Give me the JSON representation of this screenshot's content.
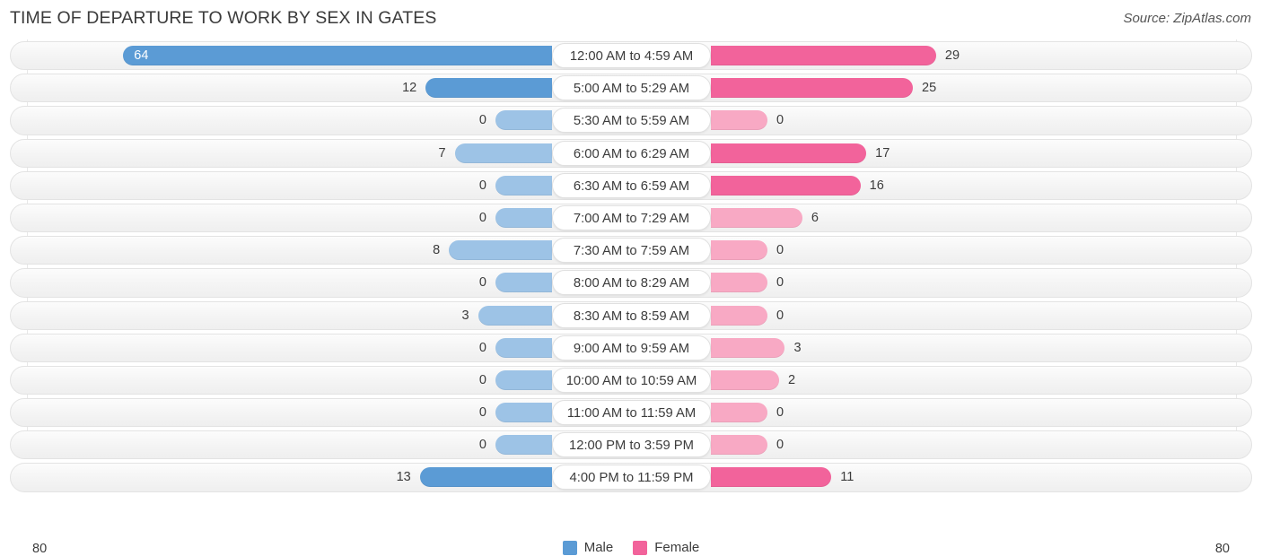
{
  "header": {
    "title": "TIME OF DEPARTURE TO WORK BY SEX IN GATES",
    "source": "Source: ZipAtlas.com"
  },
  "axis": {
    "left_label": "80",
    "right_label": "80",
    "max": 80
  },
  "legend": {
    "items": [
      {
        "label": "Male",
        "color": "#5b9bd5"
      },
      {
        "label": "Female",
        "color": "#f2639b"
      }
    ]
  },
  "colors": {
    "male_strong": "#5b9bd5",
    "male_light": "#9dc3e6",
    "female_strong": "#f2639b",
    "female_light": "#f8a9c4",
    "track": "#f4f4f4",
    "text": "#3c3c3c"
  },
  "chart_data": {
    "type": "bar",
    "title": "TIME OF DEPARTURE TO WORK BY SEX IN GATES",
    "subtitle": "",
    "xlabel": "",
    "ylabel": "",
    "orientation": "horizontal-diverging",
    "grid": true,
    "legend_position": "bottom-center",
    "xlim": [
      80,
      80
    ],
    "categories": [
      "12:00 AM to 4:59 AM",
      "5:00 AM to 5:29 AM",
      "5:30 AM to 5:59 AM",
      "6:00 AM to 6:29 AM",
      "6:30 AM to 6:59 AM",
      "7:00 AM to 7:29 AM",
      "7:30 AM to 7:59 AM",
      "8:00 AM to 8:29 AM",
      "8:30 AM to 8:59 AM",
      "9:00 AM to 9:59 AM",
      "10:00 AM to 10:59 AM",
      "11:00 AM to 11:59 AM",
      "12:00 PM to 3:59 PM",
      "4:00 PM to 11:59 PM"
    ],
    "series": [
      {
        "name": "Male",
        "side": "left",
        "color": "#5b9bd5",
        "values": [
          64,
          12,
          0,
          7,
          0,
          0,
          8,
          0,
          3,
          0,
          0,
          0,
          0,
          13
        ]
      },
      {
        "name": "Female",
        "side": "right",
        "color": "#f2639b",
        "values": [
          29,
          25,
          0,
          17,
          16,
          6,
          0,
          0,
          0,
          3,
          2,
          0,
          0,
          11
        ]
      }
    ]
  },
  "rows": [
    {
      "label": "12:00 AM to 4:59 AM",
      "male": "64",
      "female": "29"
    },
    {
      "label": "5:00 AM to 5:29 AM",
      "male": "12",
      "female": "25"
    },
    {
      "label": "5:30 AM to 5:59 AM",
      "male": "0",
      "female": "0"
    },
    {
      "label": "6:00 AM to 6:29 AM",
      "male": "7",
      "female": "17"
    },
    {
      "label": "6:30 AM to 6:59 AM",
      "male": "0",
      "female": "16"
    },
    {
      "label": "7:00 AM to 7:29 AM",
      "male": "0",
      "female": "6"
    },
    {
      "label": "7:30 AM to 7:59 AM",
      "male": "8",
      "female": "0"
    },
    {
      "label": "8:00 AM to 8:29 AM",
      "male": "0",
      "female": "0"
    },
    {
      "label": "8:30 AM to 8:59 AM",
      "male": "3",
      "female": "0"
    },
    {
      "label": "9:00 AM to 9:59 AM",
      "male": "0",
      "female": "3"
    },
    {
      "label": "10:00 AM to 10:59 AM",
      "male": "0",
      "female": "2"
    },
    {
      "label": "11:00 AM to 11:59 AM",
      "male": "0",
      "female": "0"
    },
    {
      "label": "12:00 PM to 3:59 PM",
      "male": "0",
      "female": "0"
    },
    {
      "label": "4:00 PM to 11:59 PM",
      "male": "13",
      "female": "11"
    }
  ]
}
